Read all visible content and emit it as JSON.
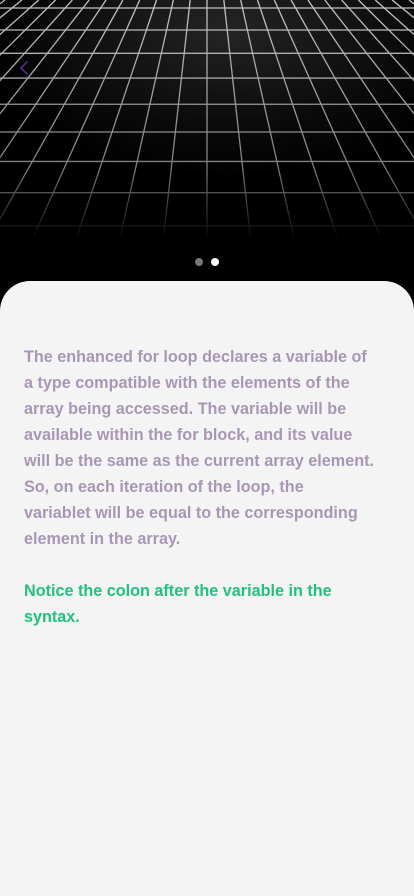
{
  "screen": {
    "body_paragraphs": [
      "The enhanced for loop declares a variable of a type compatible with the elements of the array being accessed. The variable will be available within the for block, and its value will be the same as the current array element.",
      "So, on each iteration of the loop, the variablet will be equal to the corresponding element in the array."
    ],
    "note": "Notice the colon after the variable in the syntax."
  },
  "pager": {
    "total": 2,
    "current": 2
  },
  "icons": {
    "back": "chevron-left-icon"
  },
  "colors": {
    "hero_background": "#000000",
    "card_background": "#f4f4f4",
    "body_text": "#a797b5",
    "note_text": "#1fc27e",
    "dot_active": "#ffffff",
    "dot_inactive": "#777777"
  }
}
